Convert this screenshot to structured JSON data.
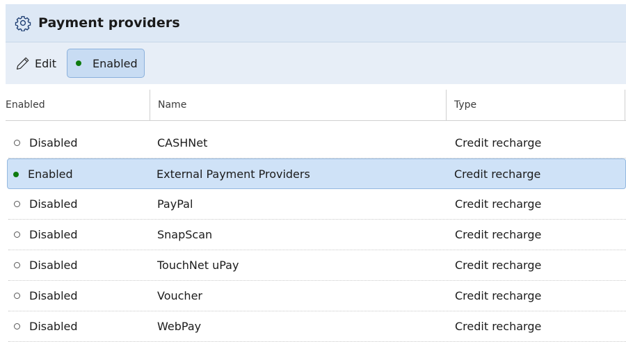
{
  "window": {
    "title": "Payment providers",
    "icon": "gear-icon"
  },
  "toolbar": {
    "edit_label": "Edit",
    "edit_icon": "pencil-icon",
    "enabled_label": "Enabled",
    "enabled_color": "#0f7b0f"
  },
  "table": {
    "headers": {
      "enabled": "Enabled",
      "name": "Name",
      "type": "Type"
    },
    "selected_index": 1,
    "rows": [
      {
        "status": "Disabled",
        "enabled": false,
        "name": "CASHNet",
        "type": "Credit recharge"
      },
      {
        "status": "Enabled",
        "enabled": true,
        "name": "External Payment Providers",
        "type": "Credit recharge"
      },
      {
        "status": "Disabled",
        "enabled": false,
        "name": "PayPal",
        "type": "Credit recharge"
      },
      {
        "status": "Disabled",
        "enabled": false,
        "name": "SnapScan",
        "type": "Credit recharge"
      },
      {
        "status": "Disabled",
        "enabled": false,
        "name": "TouchNet uPay",
        "type": "Credit recharge"
      },
      {
        "status": "Disabled",
        "enabled": false,
        "name": "Voucher",
        "type": "Credit recharge"
      },
      {
        "status": "Disabled",
        "enabled": false,
        "name": "WebPay",
        "type": "Credit recharge"
      }
    ]
  }
}
